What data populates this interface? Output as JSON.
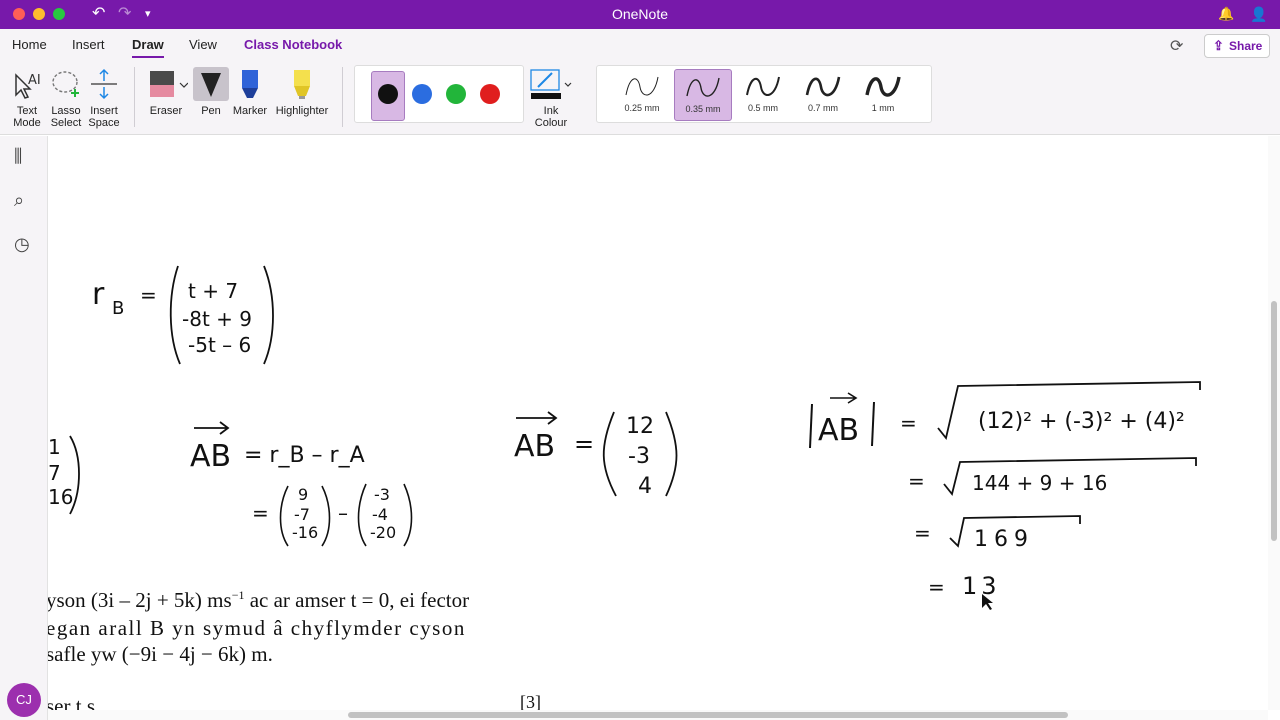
{
  "window": {
    "title": "OneNote"
  },
  "menu": {
    "tabs": [
      "Home",
      "Insert",
      "Draw",
      "View",
      "Class Notebook"
    ],
    "share_label": "Share"
  },
  "ribbon": {
    "text_mode": "Text Mode",
    "lasso_select": "Lasso Select",
    "insert_space": "Insert Space",
    "eraser": "Eraser",
    "pen": "Pen",
    "marker": "Marker",
    "highlighter": "Highlighter",
    "ink_colour": "Ink Colour",
    "colors": [
      "#111111",
      "#2b6de0",
      "#22b53a",
      "#e01e1e"
    ],
    "thicknesses": [
      "0.25 mm",
      "0.35 mm",
      "0.5 mm",
      "0.7 mm",
      "1 mm"
    ],
    "selected_thickness": "0.35 mm"
  },
  "user": {
    "initials": "CJ"
  },
  "page": {
    "text_line1_prefix": "yson (3",
    "text_line1_rest": "i – 2j + 5k) ms",
    "text_line1_sup": "−1",
    "text_line1_end": " ac ar amser t = 0, ei fector",
    "text_line2": "egan arall B yn symud â chyflymder cyson",
    "text_line3": "safle yw (−9i − 4j − 6k) m.",
    "text_line4": "ser t s",
    "marks": "[3]"
  },
  "ink": {
    "rB_label": "r",
    "rB_sub": "B",
    "rB_eq": "=",
    "rB_rows": [
      "t + 7",
      "-8t + 9",
      "-5t – 6"
    ],
    "partial_rows": [
      "1",
      "7",
      "16"
    ],
    "AB_label": "AB",
    "AB_eq1": "= r_B – r_A",
    "AB_vec1": [
      "9",
      "-7",
      "-16"
    ],
    "AB_vec2": [
      "-3",
      "-4",
      "-20"
    ],
    "AB_result": [
      "12",
      "-3",
      "4"
    ],
    "mag_line1": "(12)² + (-3)² + (4)²",
    "mag_line2": "144 + 9 + 16",
    "mag_line3": "169",
    "mag_result": "13"
  }
}
